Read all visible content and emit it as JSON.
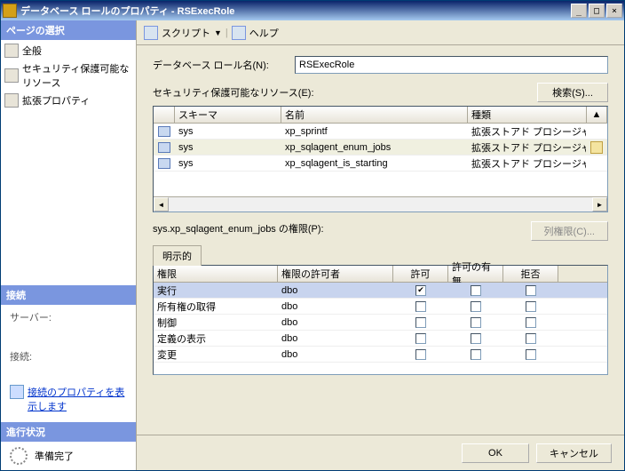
{
  "titlebar": {
    "text": "データベース ロールのプロパティ - RSExecRole"
  },
  "toolbar": {
    "script": "スクリプト",
    "help": "ヘルプ"
  },
  "left": {
    "pages_header": "ページの選択",
    "nav": [
      {
        "label": "全般"
      },
      {
        "label": "セキュリティ保護可能なリソース"
      },
      {
        "label": "拡張プロパティ"
      }
    ],
    "connection_header": "接続",
    "server_label": "サーバー:",
    "server_value": "",
    "conn_label": "接続:",
    "conn_value": "",
    "view_conn_props": "接続のプロパティを表示します",
    "progress_header": "進行状況",
    "progress_text": "準備完了"
  },
  "content": {
    "role_name_label": "データベース ロール名(N):",
    "role_name_value": "RSExecRole",
    "securables_label": "セキュリティ保護可能なリソース(E):",
    "search_button": "検索(S)...",
    "grid_headers": {
      "schema": "スキーマ",
      "name": "名前",
      "type": "種類"
    },
    "grid_rows": [
      {
        "schema": "sys",
        "name": "xp_sprintf",
        "type": "拡張ストアド プロシージャ",
        "selected": false,
        "edit": false
      },
      {
        "schema": "sys",
        "name": "xp_sqlagent_enum_jobs",
        "type": "拡張ストアド プロシージャ",
        "selected": true,
        "edit": true
      },
      {
        "schema": "sys",
        "name": "xp_sqlagent_is_starting",
        "type": "拡張ストアド プロシージャ",
        "selected": false,
        "edit": false
      }
    ],
    "perms_label": "sys.xp_sqlagent_enum_jobs の権限(P):",
    "col_perms_button": "列権限(C)...",
    "tab_explicit": "明示的",
    "perm_headers": {
      "perm": "権限",
      "grantor": "権限の許可者",
      "grant": "許可",
      "withgrant": "許可の有無",
      "deny": "拒否"
    },
    "perm_rows": [
      {
        "perm": "実行",
        "grantor": "dbo",
        "grant": true,
        "withgrant": false,
        "deny": false,
        "selected": true
      },
      {
        "perm": "所有権の取得",
        "grantor": "dbo",
        "grant": false,
        "withgrant": false,
        "deny": false,
        "selected": false
      },
      {
        "perm": "制御",
        "grantor": "dbo",
        "grant": false,
        "withgrant": false,
        "deny": false,
        "selected": false
      },
      {
        "perm": "定義の表示",
        "grantor": "dbo",
        "grant": false,
        "withgrant": false,
        "deny": false,
        "selected": false
      },
      {
        "perm": "変更",
        "grantor": "dbo",
        "grant": false,
        "withgrant": false,
        "deny": false,
        "selected": false
      }
    ]
  },
  "footer": {
    "ok": "OK",
    "cancel": "キャンセル"
  }
}
